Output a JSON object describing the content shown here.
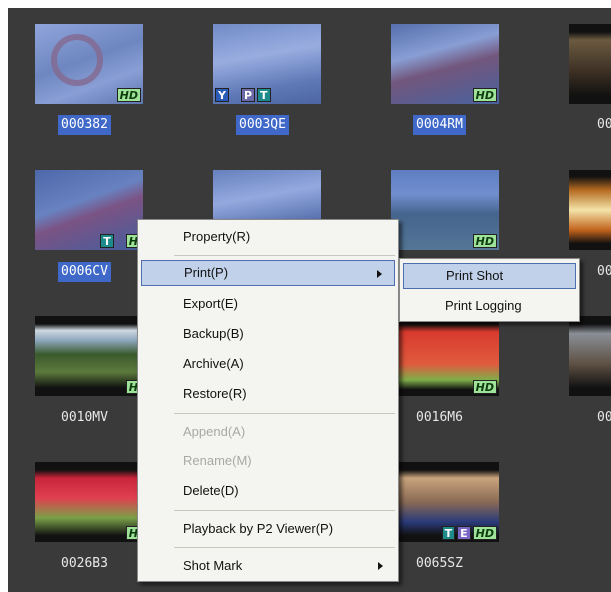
{
  "clips": [
    {
      "id": "000382",
      "badges": [
        "HD"
      ],
      "selected": true
    },
    {
      "id": "0003QE",
      "badges": [
        "Y",
        "P",
        "T"
      ],
      "selected": true
    },
    {
      "id": "0004RM",
      "badges": [
        "HD"
      ],
      "selected": true
    },
    {
      "id": "00",
      "badges": [],
      "selected": false
    },
    {
      "id": "0006CV",
      "badges": [
        "T",
        "H"
      ],
      "selected": true
    },
    {
      "id": "",
      "badges": [],
      "selected": false
    },
    {
      "id": "",
      "badges": [
        "HD"
      ],
      "selected": false
    },
    {
      "id": "00",
      "badges": [],
      "selected": false
    },
    {
      "id": "0010MV",
      "badges": [
        "H"
      ],
      "selected": false
    },
    {
      "id": "0016M6",
      "badges": [
        "HD"
      ],
      "selected": false
    },
    {
      "id": "00",
      "badges": [],
      "selected": false
    },
    {
      "id": "0026B3",
      "badges": [
        "H"
      ],
      "selected": false
    },
    {
      "id": "0065SZ",
      "badges": [
        "T",
        "E",
        "HD"
      ],
      "selected": false
    }
  ],
  "context_menu": {
    "items": [
      {
        "label": "Property(R)",
        "enabled": true
      },
      {
        "label": "Print(P)",
        "enabled": true,
        "submenu": true,
        "highlighted": true
      },
      {
        "label": "Export(E)",
        "enabled": true
      },
      {
        "label": "Backup(B)",
        "enabled": true
      },
      {
        "label": "Archive(A)",
        "enabled": true
      },
      {
        "label": "Restore(R)",
        "enabled": true
      },
      {
        "label": "Append(A)",
        "enabled": false
      },
      {
        "label": "Rename(M)",
        "enabled": false
      },
      {
        "label": "Delete(D)",
        "enabled": true
      },
      {
        "label": "Playback by P2 Viewer(P)",
        "enabled": true
      },
      {
        "label": "Shot Mark",
        "enabled": true,
        "submenu": true
      }
    ]
  },
  "print_submenu": {
    "items": [
      {
        "label": "Print Shot",
        "highlighted": true
      },
      {
        "label": "Print Logging",
        "highlighted": false
      }
    ]
  },
  "colors": {
    "background": "#3a3a3a",
    "selection": "#3f68c8",
    "menu_bg": "#f4f4f0",
    "hd_badge": "#9fe29a"
  }
}
